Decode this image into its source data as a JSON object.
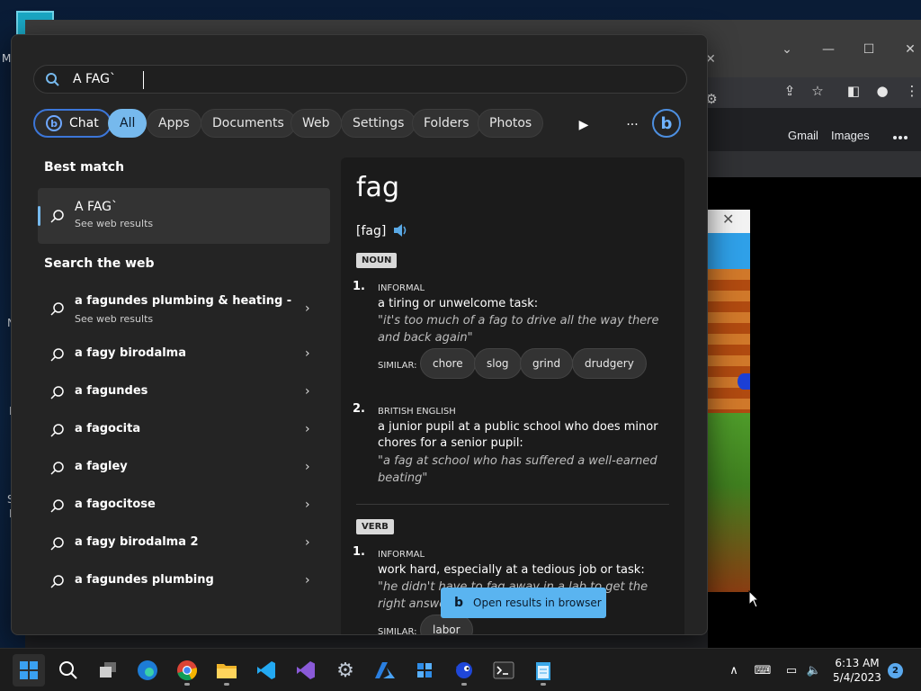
{
  "desktop": {
    "side_labels": [
      "M",
      "N",
      "I",
      "S",
      "E"
    ]
  },
  "browser": {
    "links": [
      "Gmail",
      "Images"
    ],
    "window_controls": [
      "minimize",
      "maximize",
      "close"
    ]
  },
  "search": {
    "query": "A FAG`",
    "filters": [
      "Chat",
      "All",
      "Apps",
      "Documents",
      "Web",
      "Settings",
      "Folders",
      "Photos"
    ],
    "active_filter": "All",
    "more_label": "···"
  },
  "best_match": {
    "heading": "Best match",
    "title": "A FAG`",
    "subtitle": "See web results"
  },
  "web": {
    "heading": "Search the web",
    "suggestions": [
      {
        "text": "a fagundes plumbing & heating -",
        "sub": "See web results"
      },
      {
        "text": "a fagy birodalma",
        "sub": ""
      },
      {
        "text": "a fagundes",
        "sub": ""
      },
      {
        "text": "a fagocita",
        "sub": ""
      },
      {
        "text": "a fagley",
        "sub": ""
      },
      {
        "text": "a fagocitose",
        "sub": ""
      },
      {
        "text": "a fagy birodalma 2",
        "sub": ""
      },
      {
        "text": "a fagundes plumbing",
        "sub": ""
      }
    ]
  },
  "definition": {
    "word": "fag",
    "pronunciation": "[fag]",
    "noun_label": "NOUN",
    "verb_label": "VERB",
    "senses": [
      {
        "num": "1.",
        "register": "INFORMAL",
        "definition": "a tiring or unwelcome task:",
        "example": "\"it's too much of a fag to drive all the way there and back again\"",
        "similar_label": "SIMILAR:",
        "similar": [
          "chore",
          "slog",
          "grind",
          "drudgery"
        ]
      },
      {
        "num": "2.",
        "register": "BRITISH ENGLISH",
        "definition": "a junior pupil at a public school who does minor chores for a senior pupil:",
        "example": "\"a fag at school who has suffered a well-earned beating\""
      }
    ],
    "verb_sense": {
      "num": "1.",
      "register": "INFORMAL",
      "definition": "work hard, especially at a tedious job or task:",
      "example": "\"he didn't have to fag away in a lab to get the right answer\"",
      "similar_label": "SIMILAR:",
      "similar": [
        "labor"
      ]
    },
    "open_in_browser": "Open results in browser"
  },
  "taskbar": {
    "time": "6:13 AM",
    "date": "5/4/2023",
    "notifications": "2",
    "apps": [
      "start-icon",
      "search-icon",
      "task-view-icon",
      "edge-icon",
      "chrome-icon",
      "file-explorer-icon",
      "vscode-icon",
      "visual-studio-icon",
      "settings-icon",
      "azure-icon",
      "dev-tools-icon",
      "sonic-icon",
      "terminal-icon",
      "notepad-icon"
    ]
  },
  "colors": {
    "accent": "#76b9ed",
    "panel": "#242424",
    "preview": "#1b1b1b",
    "taskbar": "#1c1c1c"
  }
}
